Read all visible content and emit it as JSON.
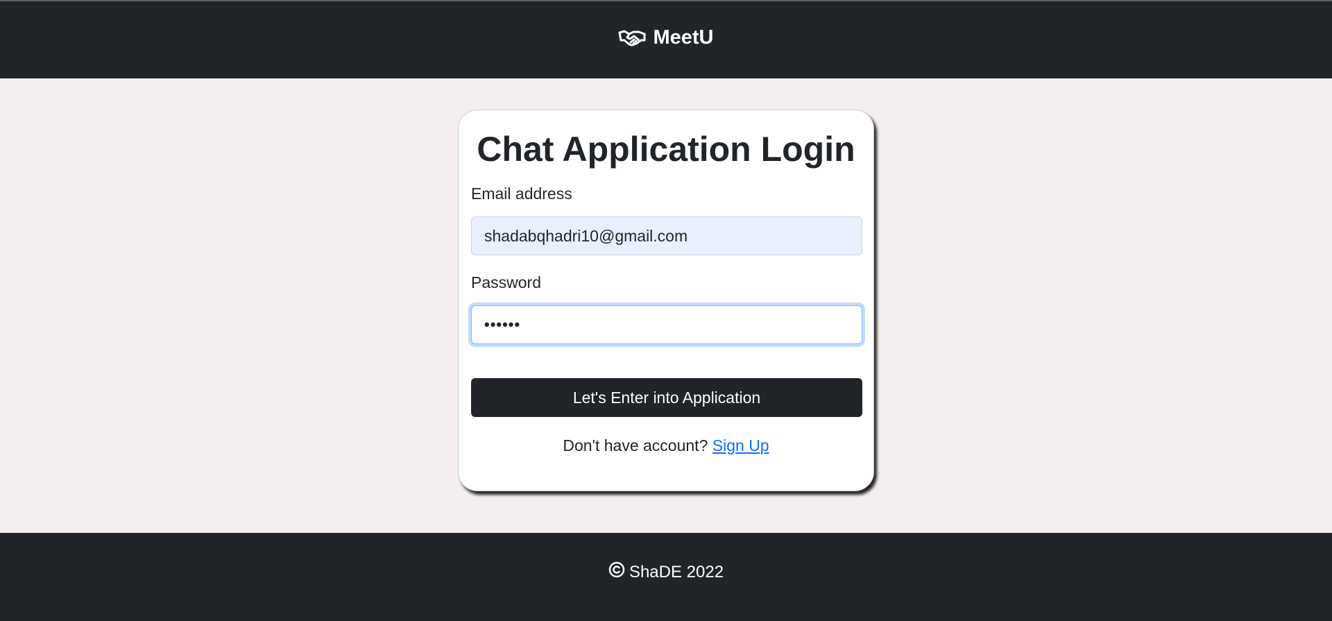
{
  "navbar": {
    "brand_icon": "handshake-icon",
    "brand_name": "MeetU"
  },
  "login": {
    "title": "Chat Application Login",
    "email_label": "Email address",
    "email_value": "shadabqhadri10@gmail.com",
    "password_label": "Password",
    "password_value": "••••••",
    "submit_label": "Let's Enter into Application",
    "signup_prompt": "Don't have account?",
    "signup_link": "Sign Up"
  },
  "footer": {
    "copyright_icon": "copyright-icon",
    "text": "ShaDE 2022"
  },
  "colors": {
    "navbar_bg": "#212529",
    "page_bg": "#f4eeee",
    "link": "#0d6efd",
    "autofill_bg": "#e8f0fe"
  }
}
